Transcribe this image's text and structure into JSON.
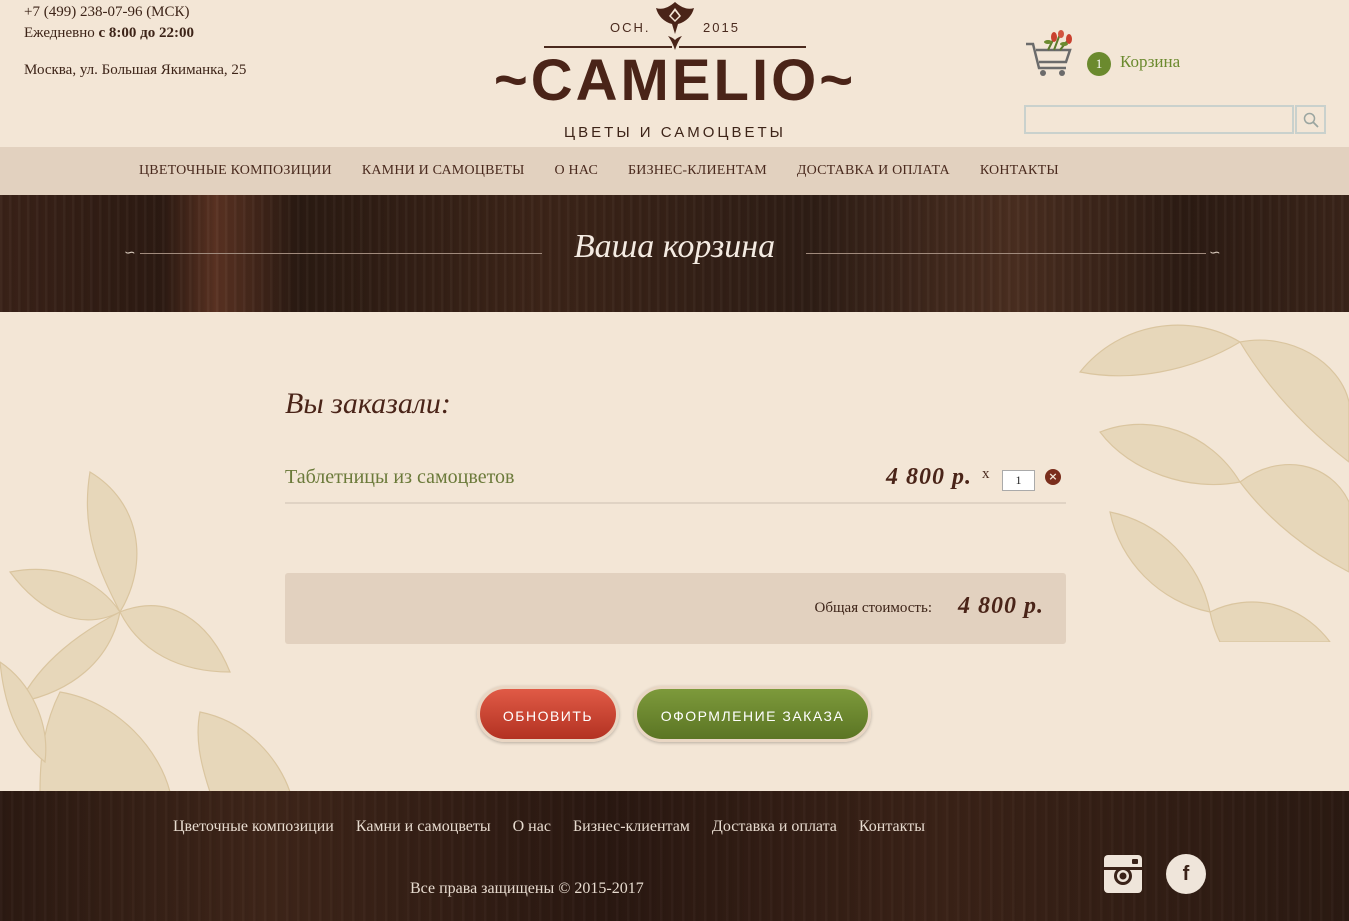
{
  "contact": {
    "phone": "+7 (499) 238-07-96 (МСК)",
    "hours_prefix": "Ежедневно",
    "hours_value": "с 8:00 до 22:00",
    "address": "Москва, ул. Большая Якиманка, 25"
  },
  "logo": {
    "est_left": "OCH.",
    "est_right": "2015",
    "name": "~CAMELIO~",
    "tagline": "ЦВЕТЫ И САМОЦВЕТЫ"
  },
  "cart": {
    "count": "1",
    "label": "Корзина"
  },
  "search": {
    "placeholder": ""
  },
  "nav": {
    "items": [
      "ЦВЕТОЧНЫЕ КОМПОЗИЦИИ",
      "КАМНИ И САМОЦВЕТЫ",
      "О НАС",
      "БИЗНЕС-КЛИЕНТАМ",
      "ДОСТАВКА И ОПЛАТА",
      "КОНТАКТЫ"
    ]
  },
  "banner": {
    "title": "Ваша корзина"
  },
  "order": {
    "title": "Вы заказали:",
    "items": [
      {
        "name": "Таблетницы из самоцветов",
        "price": "4 800 р.",
        "times": "x",
        "quantity": "1"
      }
    ],
    "total_label": "Общая стоимость:",
    "total_value": "4 800 р."
  },
  "buttons": {
    "update": "ОБНОВИТЬ",
    "checkout": "ОФОРМЛЕНИЕ ЗАКАЗА"
  },
  "footer": {
    "links": [
      "Цветочные композиции",
      "Камни и самоцветы",
      "О нас",
      "Бизнес-клиентам",
      "Доставка и оплата",
      "Контакты"
    ],
    "copyright": "Все права защищены © 2015-2017"
  },
  "colors": {
    "background": "#f3e6d6",
    "brown": "#4a2418",
    "green": "#6b8a2e",
    "red": "#c9402e",
    "nav_bg": "#e2d1bf"
  },
  "icons": [
    "cart-icon",
    "search-icon",
    "remove-icon",
    "instagram-icon",
    "facebook-icon"
  ]
}
